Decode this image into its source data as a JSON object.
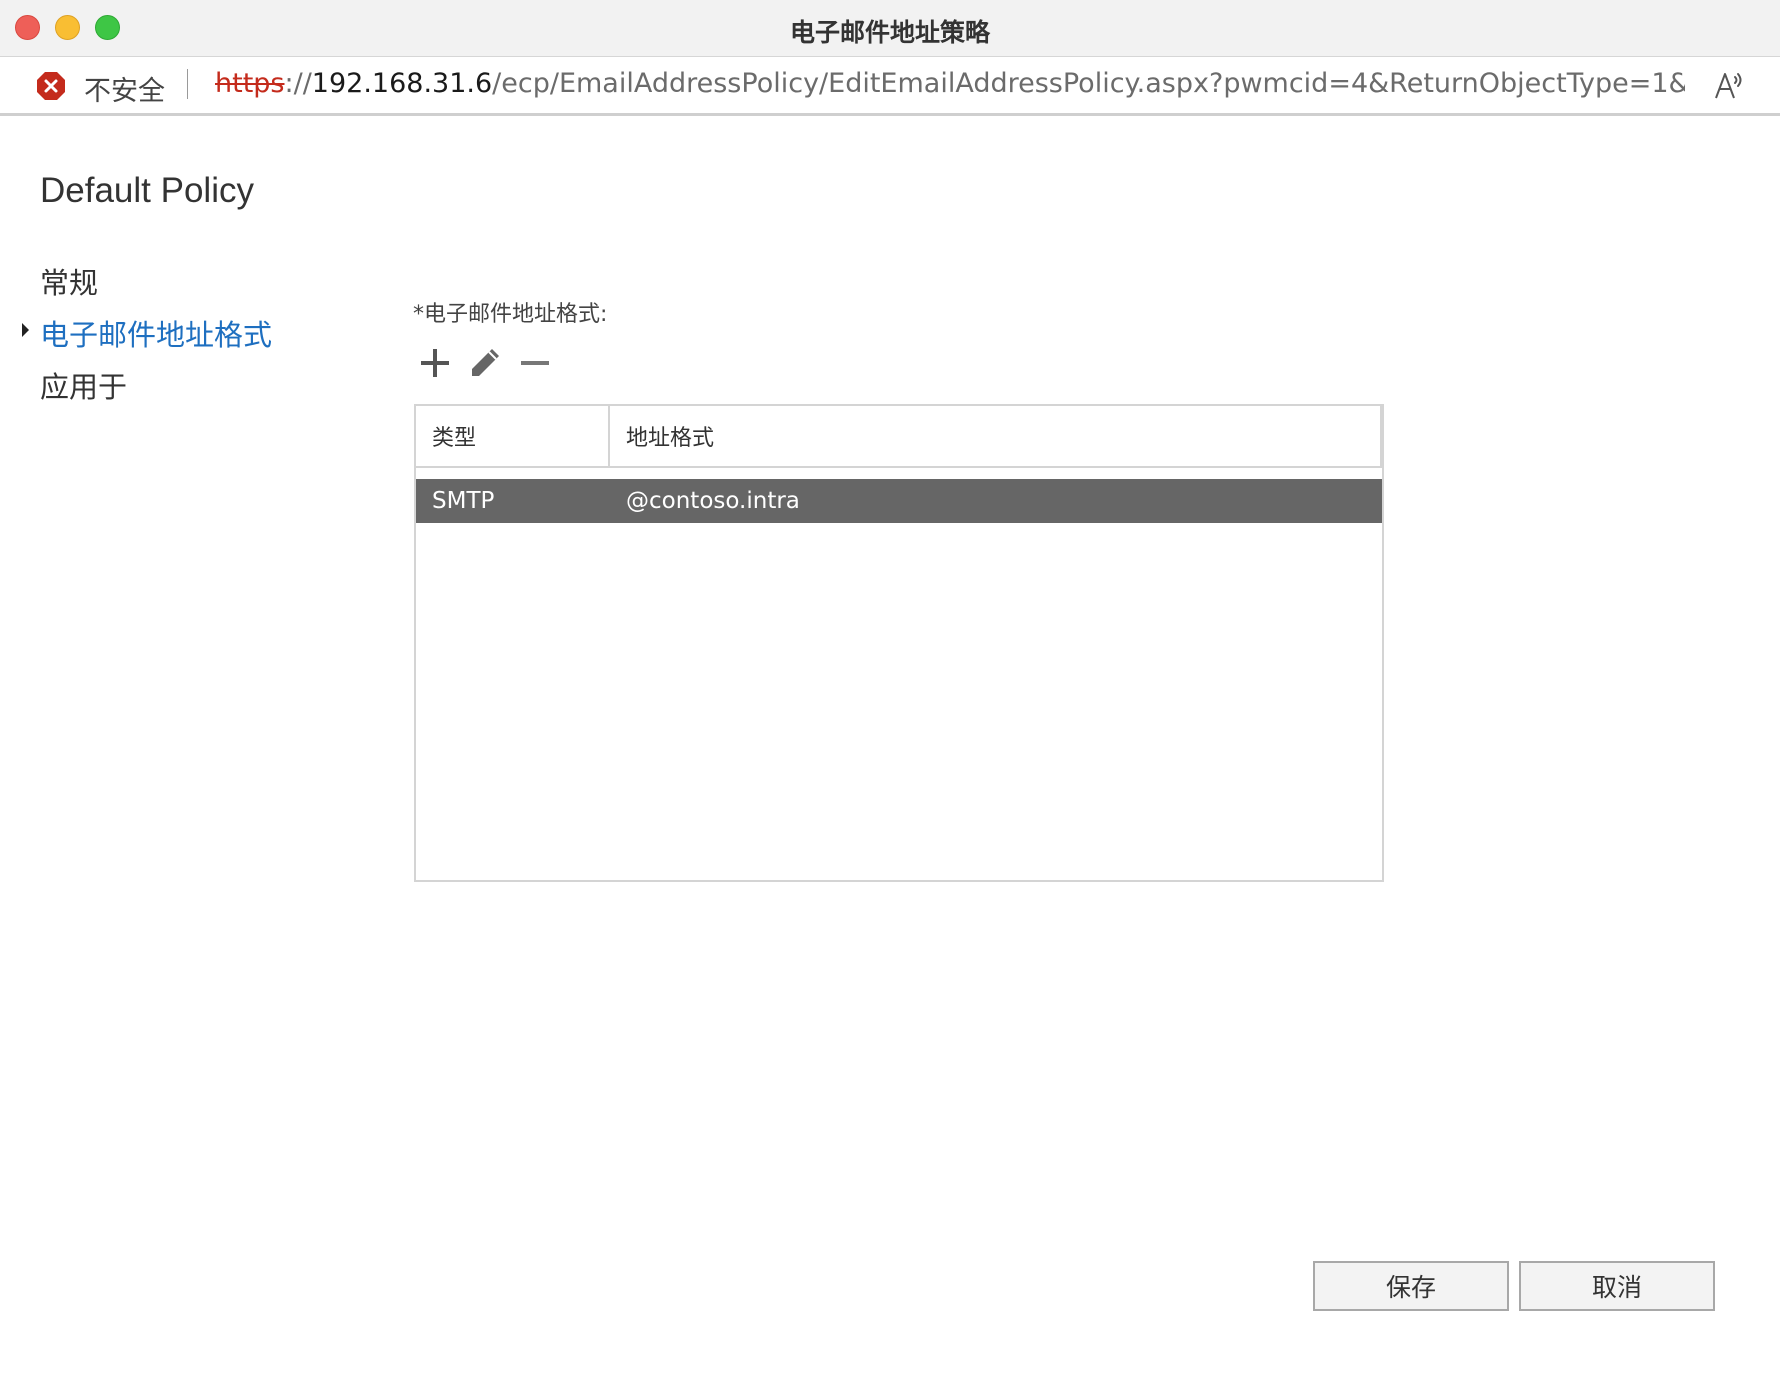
{
  "window": {
    "title": "电子邮件地址策略"
  },
  "addressbar": {
    "security_label": "不安全",
    "url_scheme": "https",
    "url_sep": "://",
    "url_host": "192.168.31.6",
    "url_rest": "/ecp/EmailAddressPolicy/EditEmailAddressPolicy.aspx?pwmcid=4&ReturnObjectType=1&…"
  },
  "page": {
    "title": "Default Policy"
  },
  "nav": {
    "items": [
      {
        "label": "常规",
        "active": false
      },
      {
        "label": "电子邮件地址格式",
        "active": true
      },
      {
        "label": "应用于",
        "active": false
      }
    ]
  },
  "main": {
    "field_label": "*电子邮件地址格式:",
    "toolbar": {
      "add_icon": "plus-icon",
      "edit_icon": "pencil-icon",
      "remove_icon": "minus-icon"
    },
    "table": {
      "columns": [
        "类型",
        "地址格式"
      ],
      "rows": [
        {
          "type": "SMTP",
          "address": "@contoso.intra",
          "selected": true
        }
      ]
    }
  },
  "buttons": {
    "save_label": "保存",
    "cancel_label": "取消"
  },
  "colors": {
    "active_nav": "#1e6fc0",
    "selected_row": "#666666",
    "insecure": "#c42b1c"
  }
}
